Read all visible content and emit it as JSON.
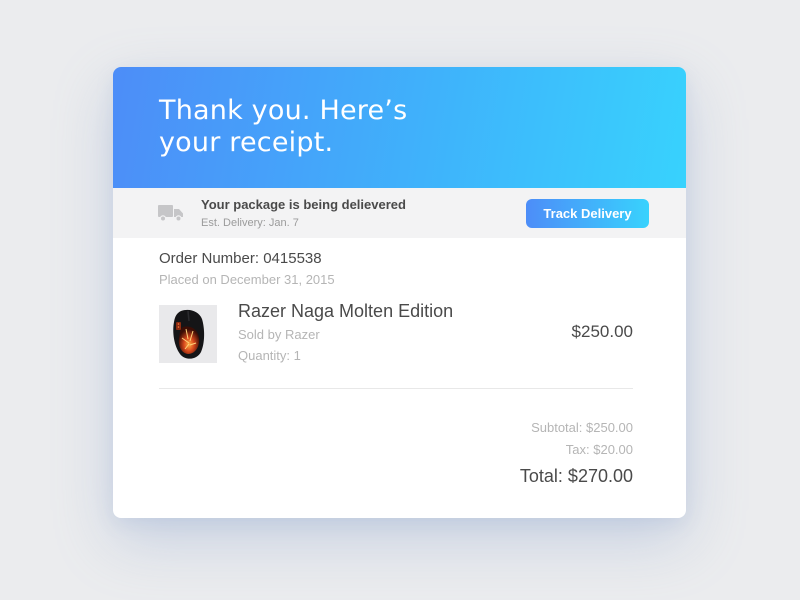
{
  "colors": {
    "page_background": "#ebecee",
    "gradient_start": "#4d8df8",
    "gradient_end": "#38d2fd",
    "status_bar_background": "#f3f3f4",
    "primary_text": "#4a4a4a",
    "muted_text": "#b5b5b5"
  },
  "header": {
    "title": "Thank you. Here’s your receipt."
  },
  "delivery": {
    "icon": "truck-icon",
    "status": "Your package is being delievered",
    "estimate": "Est. Delivery: Jan. 7",
    "track_button_label": "Track Delivery"
  },
  "order": {
    "number_label": "Order Number: 0415538",
    "placed_on": "Placed on December 31, 2015"
  },
  "item": {
    "name": "Razer Naga Molten Edition",
    "sold_by": "Sold by Razer",
    "quantity": "Quantity: 1",
    "price": "$250.00"
  },
  "summary": {
    "subtotal": "Subtotal: $250.00",
    "tax": "Tax: $20.00",
    "total": "Total: $270.00"
  }
}
